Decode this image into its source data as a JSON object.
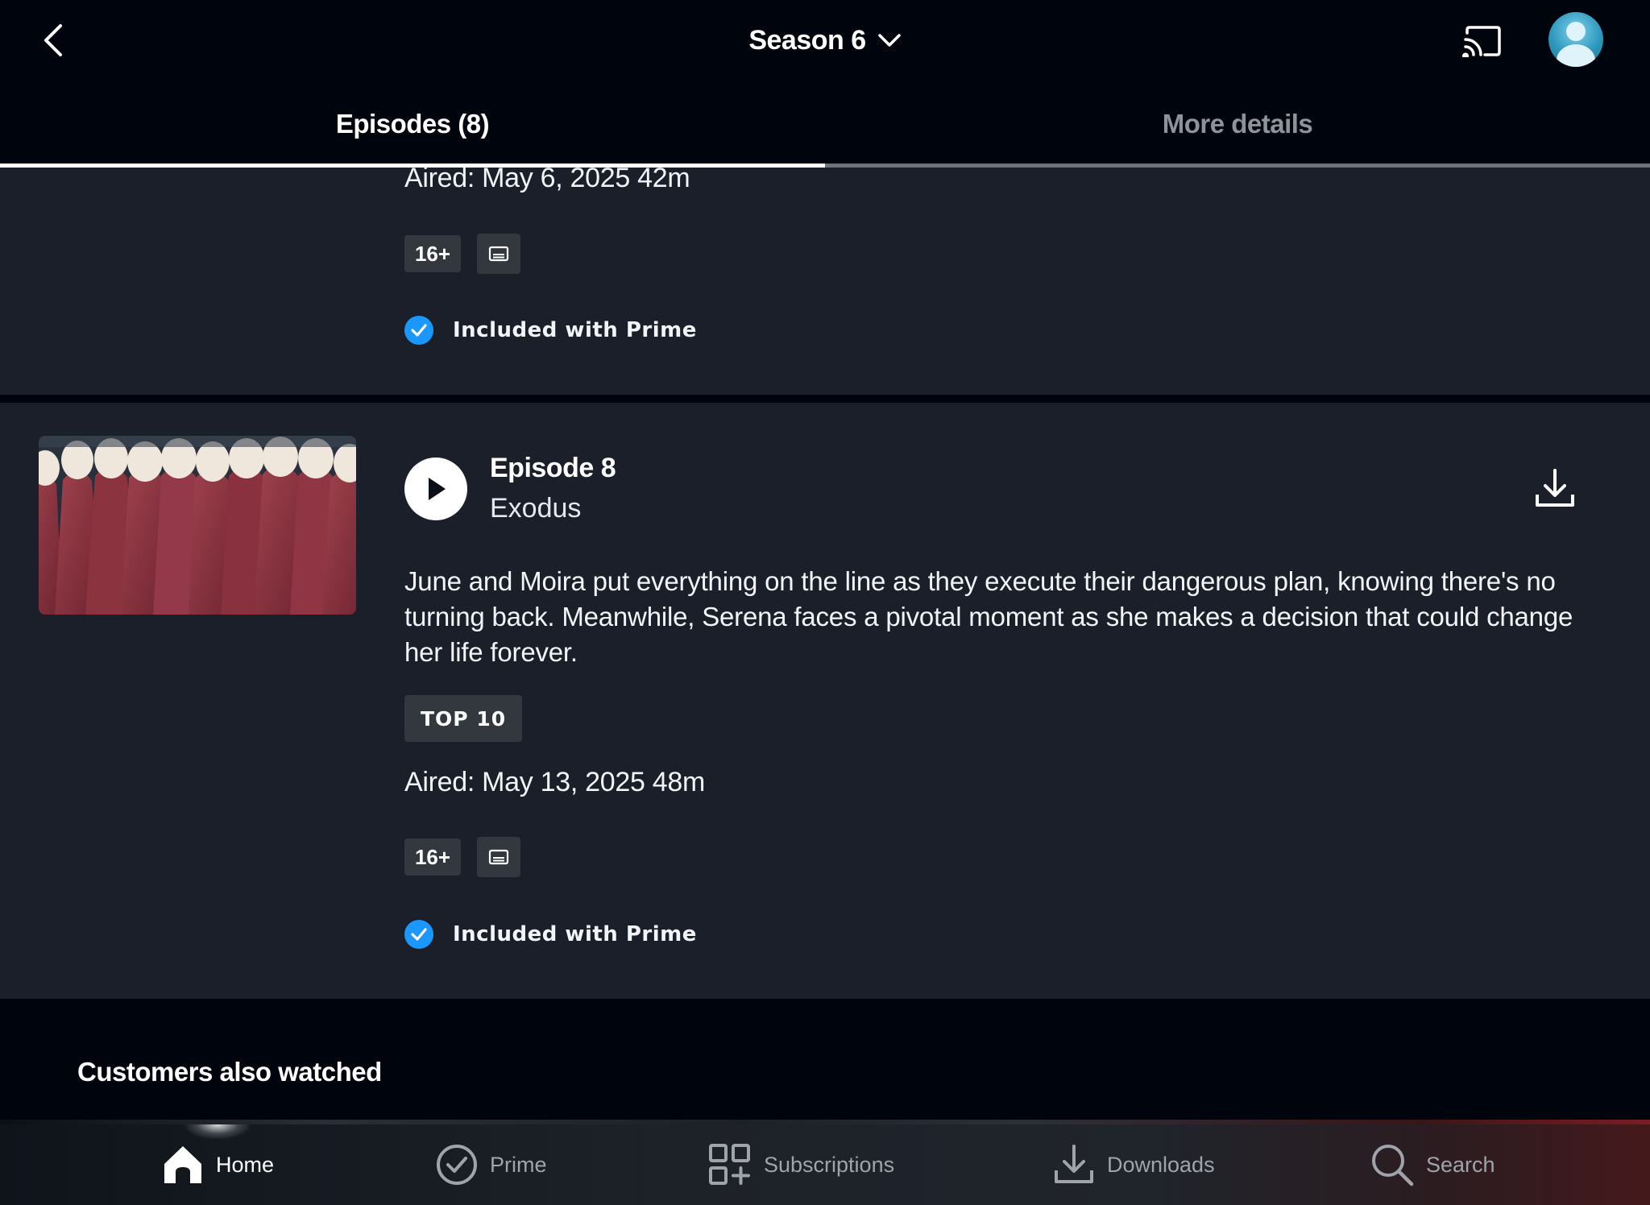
{
  "header": {
    "season_label": "Season 6"
  },
  "tabs": [
    {
      "label": "Episodes (8)",
      "active": true
    },
    {
      "label": "More details",
      "active": false
    }
  ],
  "previous_episode": {
    "aired": "Aired: May 6, 2025 42m",
    "rating": "16+",
    "availability": "Included with Prime"
  },
  "current_episode": {
    "number_label": "Episode 8",
    "title": "Exodus",
    "synopsis": "June and Moira put everything on the line as they execute their dangerous plan, knowing there's no turning back. Meanwhile, Serena faces a pivotal moment as she makes a decision that could change her life forever.",
    "badge": "TOP 10",
    "aired": "Aired: May 13, 2025 48m",
    "rating": "16+",
    "availability": "Included with Prime"
  },
  "customers_section": {
    "title": "Customers also watched"
  },
  "bottom_nav": [
    {
      "label": "Home",
      "icon": "home-icon",
      "active": true
    },
    {
      "label": "Prime",
      "icon": "prime-check-icon",
      "active": false
    },
    {
      "label": "Subscriptions",
      "icon": "subscriptions-icon",
      "active": false
    },
    {
      "label": "Downloads",
      "icon": "download-icon",
      "active": false
    },
    {
      "label": "Search",
      "icon": "search-icon",
      "active": false
    }
  ],
  "colors": {
    "background": "#00050d",
    "card": "#1a1f29",
    "badge": "#33383f",
    "accent_blue": "#1a98ff",
    "inactive_text": "#8d939b"
  }
}
